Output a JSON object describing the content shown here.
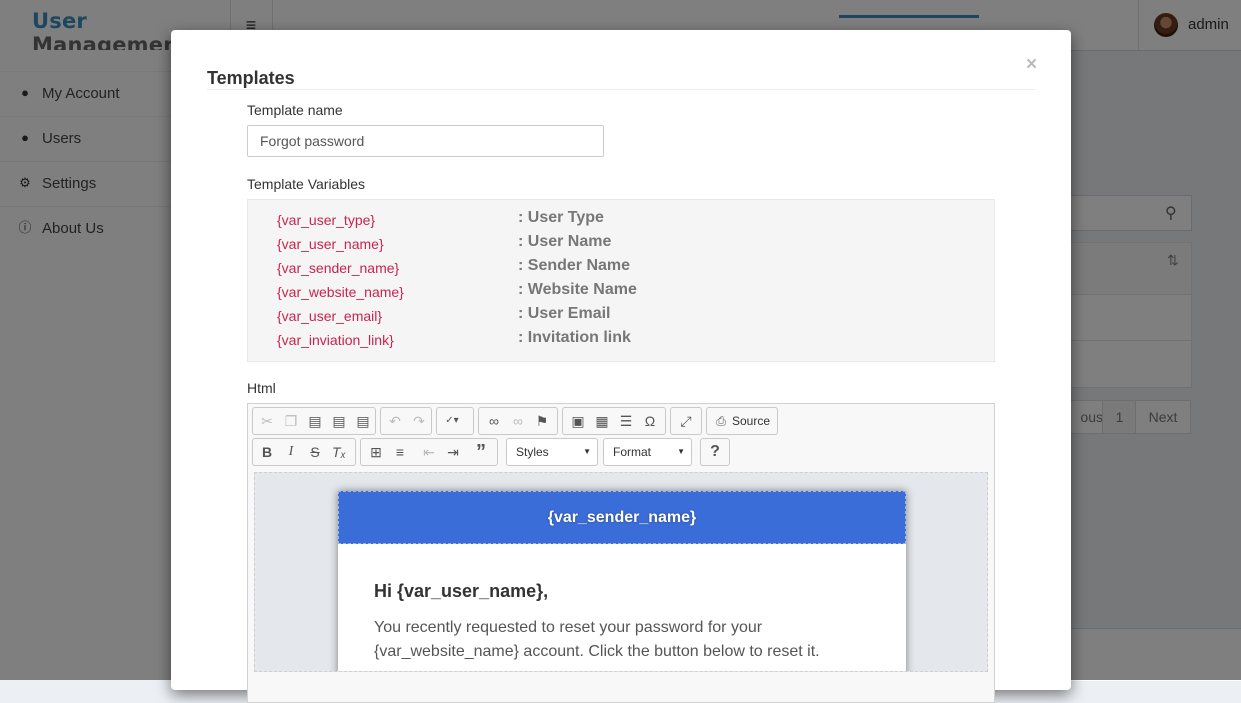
{
  "app": {
    "logo_part1": "User",
    "logo_part2": "Management",
    "user_name": "admin"
  },
  "sidebar": {
    "items": [
      {
        "label": "My Account",
        "icon": "user-icon"
      },
      {
        "label": "Users",
        "icon": "users-icon"
      },
      {
        "label": "Settings",
        "icon": "gears-icon"
      },
      {
        "label": "About Us",
        "icon": "info-icon"
      }
    ]
  },
  "background": {
    "pagination": {
      "prev": "ous",
      "page": "1",
      "next": "Next"
    }
  },
  "modal": {
    "title": "Templates",
    "close": "×",
    "template_name_label": "Template name",
    "template_name_value": "Forgot password",
    "variables_label": "Template Variables",
    "variables": [
      {
        "key": "{var_user_type}",
        "desc": ": User Type"
      },
      {
        "key": "{var_user_name}",
        "desc": ": User Name"
      },
      {
        "key": "{var_sender_name}",
        "desc": ": Sender Name"
      },
      {
        "key": "{var_website_name}",
        "desc": ": Website Name"
      },
      {
        "key": "{var_user_email}",
        "desc": ": User Email"
      },
      {
        "key": "{var_inviation_link}",
        "desc": ": Invitation link"
      }
    ],
    "html_label": "Html",
    "editor": {
      "source_label": "Source",
      "styles_label": "Styles",
      "format_label": "Format",
      "help_label": "?"
    },
    "email": {
      "header": "{var_sender_name}",
      "greeting": "Hi {var_user_name},",
      "body": "You recently requested to reset your password for your {var_website_name} account. Click the button below to reset it."
    }
  },
  "colors": {
    "accent": "#3c8dbc",
    "variable_key": "#c7254e",
    "email_header": "#3b6dd9"
  }
}
